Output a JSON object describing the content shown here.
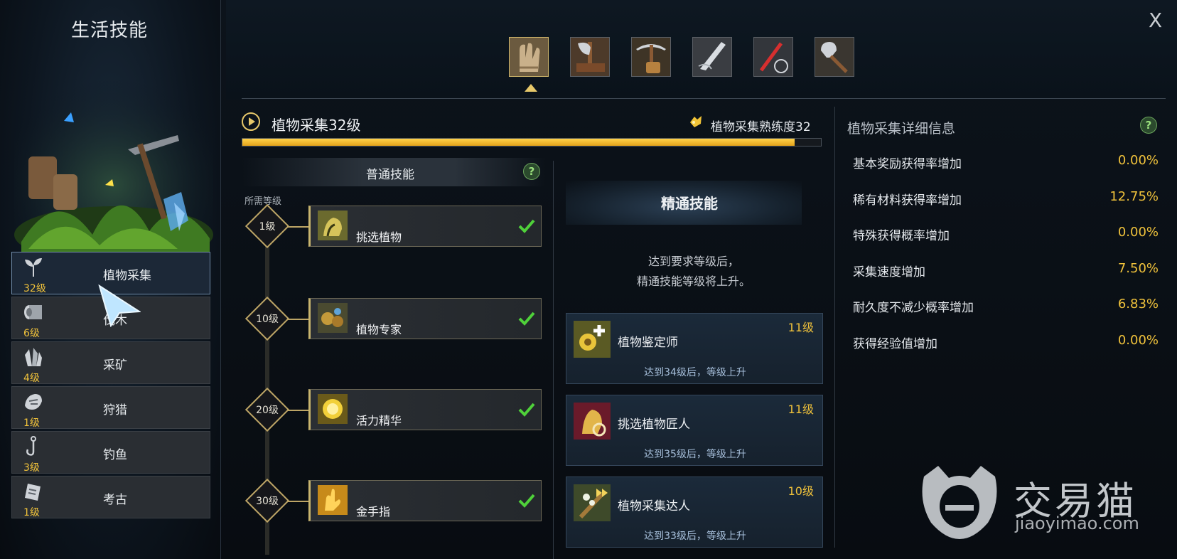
{
  "window": {
    "close_label": "X"
  },
  "left": {
    "title": "生活技能",
    "categories": [
      {
        "name": "植物采集",
        "level": "32级",
        "icon": "sprout-icon",
        "selected": true
      },
      {
        "name": "伐木",
        "level": "6级",
        "icon": "log-icon"
      },
      {
        "name": "采矿",
        "level": "4级",
        "icon": "crystal-icon"
      },
      {
        "name": "狩猎",
        "level": "1级",
        "icon": "paw-icon"
      },
      {
        "name": "钓鱼",
        "level": "3级",
        "icon": "fishhook-icon"
      },
      {
        "name": "考古",
        "level": "1级",
        "icon": "scroll-icon"
      }
    ]
  },
  "tools": [
    "gloves-icon",
    "axe-icon",
    "pickaxe-icon",
    "knife-icon",
    "fishing-rod-icon",
    "shovel-icon"
  ],
  "header": {
    "skill_title": "植物采集32级",
    "proficiency": "植物采集熟练度32",
    "progress_fraction": 0.955
  },
  "normal": {
    "title": "普通技能",
    "help": "?",
    "req_label": "所需等级",
    "skills": [
      {
        "level": "1级",
        "name": "挑选植物",
        "icon": "pick-plant-icon",
        "learned": true
      },
      {
        "level": "10级",
        "name": "植物专家",
        "icon": "plant-expert-icon",
        "learned": true
      },
      {
        "level": "20级",
        "name": "活力精华",
        "icon": "vitality-essence-icon",
        "learned": true
      },
      {
        "level": "30级",
        "name": "金手指",
        "icon": "golden-finger-icon",
        "learned": true
      }
    ]
  },
  "master": {
    "title": "精通技能",
    "desc_line1": "达到要求等级后，",
    "desc_line2": "精通技能等级将上升。",
    "skills": [
      {
        "name": "植物鉴定师",
        "level": "11级",
        "note": "达到34级后，等级上升",
        "icon": "plant-appraiser-icon"
      },
      {
        "name": "挑选植物匠人",
        "level": "11级",
        "note": "达到35级后，等级上升",
        "icon": "plant-artisan-icon"
      },
      {
        "name": "植物采集达人",
        "level": "10级",
        "note": "达到33级后，等级上升",
        "icon": "plant-master-icon"
      }
    ]
  },
  "detail": {
    "title": "植物采集详细信息",
    "help": "?",
    "rows": [
      {
        "label": "基本奖励获得率增加",
        "value": "0.00%"
      },
      {
        "label": "稀有材料获得率增加",
        "value": "12.75%"
      },
      {
        "label": "特殊获得概率增加",
        "value": "0.00%"
      },
      {
        "label": "采集速度增加",
        "value": "7.50%"
      },
      {
        "label": "耐久度不减少概率增加",
        "value": "6.83%"
      },
      {
        "label": "获得经验值增加",
        "value": "0.00%"
      }
    ]
  },
  "watermark": {
    "cn": "交易猫",
    "en": "jiaoyimao.com"
  },
  "colors": {
    "gold": "#f0c23b",
    "accent": "#e7c86a",
    "check": "#4fd13a"
  }
}
